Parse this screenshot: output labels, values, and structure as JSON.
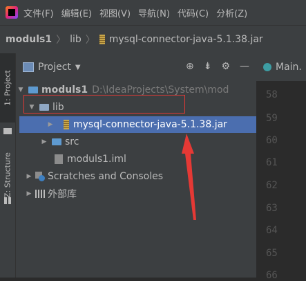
{
  "menu": {
    "items": [
      "文件(F)",
      "编辑(E)",
      "视图(V)",
      "导航(N)",
      "代码(C)",
      "分析(Z)"
    ]
  },
  "breadcrumb": {
    "project": "moduls1",
    "folder": "lib",
    "file": "mysql-connector-java-5.1.38.jar"
  },
  "sidebar": {
    "project_tab": "1: Project",
    "structure_tab": "Z: Structure"
  },
  "panel": {
    "title": "Project",
    "tree": [
      {
        "label": "moduls1",
        "path": "D:\\IdeaProjects\\System\\mod"
      },
      {
        "label": "lib"
      },
      {
        "label": "mysql-connector-java-5.1.38.jar"
      },
      {
        "label": "src"
      },
      {
        "label": "moduls1.iml"
      },
      {
        "label": "Scratches and Consoles"
      },
      {
        "label": "外部库"
      }
    ]
  },
  "editor": {
    "tab_label": "Main.",
    "line_numbers": [
      "58",
      "59",
      "60",
      "61",
      "62",
      "63",
      "64",
      "65",
      "66"
    ]
  },
  "colors": {
    "selection": "#4b6eaf",
    "annotation_red": "#e53935"
  }
}
